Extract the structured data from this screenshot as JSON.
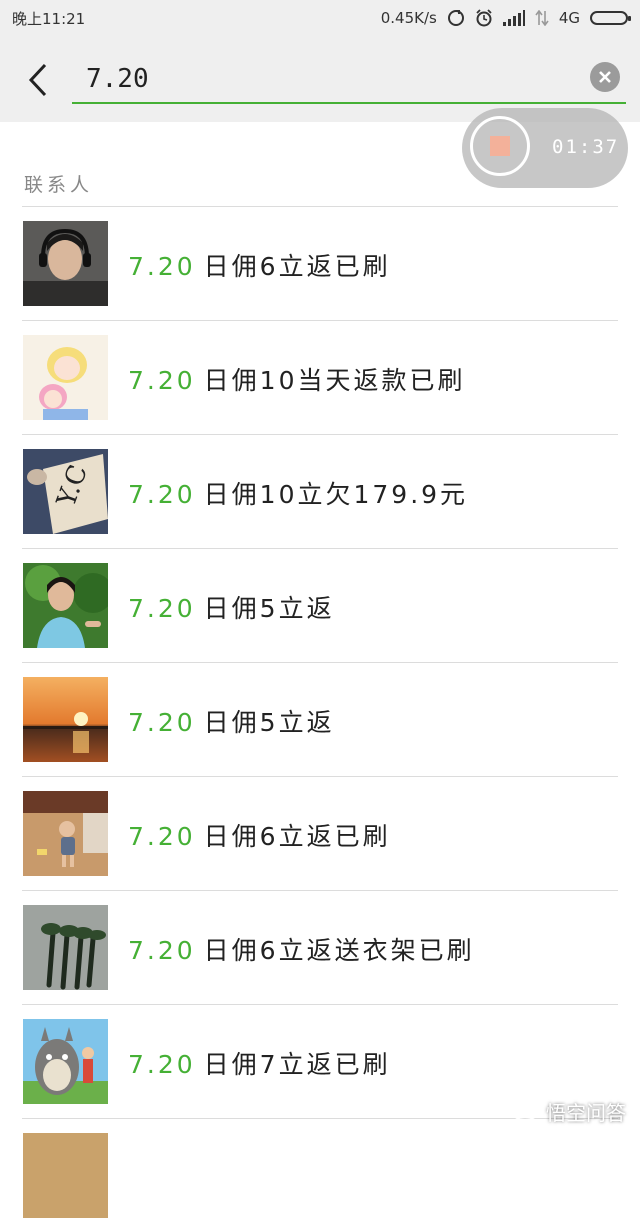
{
  "status_bar": {
    "time": "晚上11:21",
    "speed": "0.45K/s",
    "network": "4G"
  },
  "search": {
    "query": "7.20",
    "accent_color": "#45b035"
  },
  "recording": {
    "elapsed": "01:37"
  },
  "section": {
    "title": "联系人"
  },
  "contacts": [
    {
      "highlight": "7.20",
      "rest": "日佣6立返已刷",
      "avatar": "man-headphones"
    },
    {
      "highlight": "7.20",
      "rest": "日佣10当天返款已刷",
      "avatar": "anime-girls"
    },
    {
      "highlight": "7.20",
      "rest": "日佣10立欠179.9元",
      "avatar": "paper-box"
    },
    {
      "highlight": "7.20",
      "rest": "日佣5立返",
      "avatar": "woman-greenery"
    },
    {
      "highlight": "7.20",
      "rest": "日佣5立返",
      "avatar": "sunset"
    },
    {
      "highlight": "7.20",
      "rest": "日佣6立返已刷",
      "avatar": "toddler"
    },
    {
      "highlight": "7.20",
      "rest": "日佣6立返送衣架已刷",
      "avatar": "pens"
    },
    {
      "highlight": "7.20",
      "rest": "日佣7立返已刷",
      "avatar": "totoro"
    }
  ],
  "watermark": {
    "text": "悟空问答"
  }
}
